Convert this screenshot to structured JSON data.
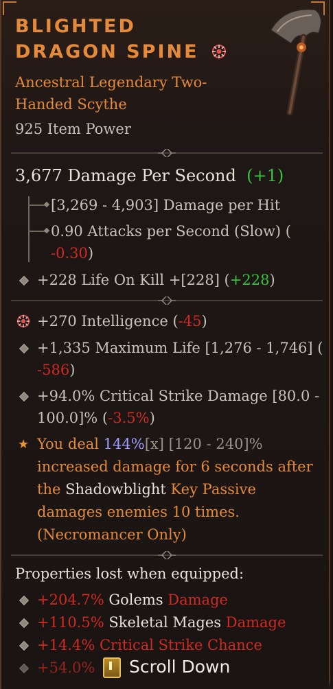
{
  "item": {
    "name_line1": "BLIGHTED",
    "name_line2": "DRAGON SPINE",
    "type_line1": "Ancestral Legendary Two-",
    "type_line2": "Handed Scythe",
    "item_power": "925 Item Power"
  },
  "weapon": {
    "dps_value": "3,677 Damage Per Second",
    "dps_diff": "(+1)",
    "damage_per_hit": "[3,269 - 4,903] Damage per Hit",
    "attacks_line1": "0.90 Attacks per Second (Slow) (",
    "attacks_diff": "-0.30",
    "attacks_close": ")",
    "life_on_kill": "+228 Life On Kill +[228] (",
    "life_on_kill_diff": "+228",
    "life_on_kill_close": ")"
  },
  "affixes": {
    "int_text": "+270 Intelligence (",
    "int_diff": "-45",
    "int_close": ")",
    "life_line1": "+1,335 Maximum Life [1,276 - 1,746] (",
    "life_diff": "-586",
    "life_close": ")",
    "crit_line1": "+94.0% Critical Strike Damage [80.0 -",
    "crit_line2_a": "100.0]% (",
    "crit_diff": "-3.5%",
    "crit_close": ")"
  },
  "legendary": {
    "p1": "You deal ",
    "value": "144%",
    "mult": "[x]",
    "range": " [120 - 240]%",
    "line2": "increased damage for 6 seconds after",
    "line3_a": "the ",
    "line3_b": "Shadowblight",
    "line3_c": " Key Passive",
    "line4": "damages enemies 10 times.",
    "line5": "(Necromancer Only)"
  },
  "lost": {
    "header": "Properties lost when equipped:",
    "items": [
      {
        "value": "+204.7%",
        "name": " Golems ",
        "tail": "Damage"
      },
      {
        "value": "+110.5%",
        "name": " Skeletal Mages ",
        "tail": "Damage"
      },
      {
        "value": "+14.4% Critical Strike Chance",
        "name": "",
        "tail": ""
      },
      {
        "value": "+54.0%",
        "name": "",
        "tail": ""
      }
    ]
  },
  "footer": {
    "scroll_label": "Scroll Down"
  },
  "colors": {
    "legendary_orange": "#e58a3b",
    "increase_green": "#35c43a",
    "decrease_red": "#d02a22",
    "value_blue": "#9d9cff"
  }
}
